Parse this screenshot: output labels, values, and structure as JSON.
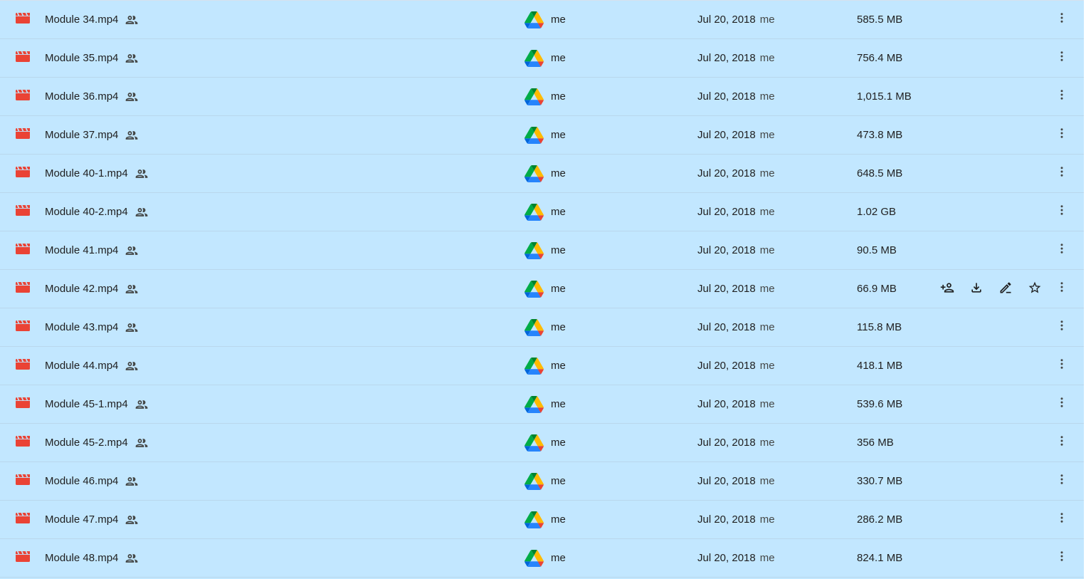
{
  "files": [
    {
      "name": "Module 34.mp4",
      "owner": "me",
      "modified_date": "Jul 20, 2018",
      "modified_by": "me",
      "size": "585.5 MB"
    },
    {
      "name": "Module 35.mp4",
      "owner": "me",
      "modified_date": "Jul 20, 2018",
      "modified_by": "me",
      "size": "756.4 MB"
    },
    {
      "name": "Module 36.mp4",
      "owner": "me",
      "modified_date": "Jul 20, 2018",
      "modified_by": "me",
      "size": "1,015.1 MB"
    },
    {
      "name": "Module 37.mp4",
      "owner": "me",
      "modified_date": "Jul 20, 2018",
      "modified_by": "me",
      "size": "473.8 MB"
    },
    {
      "name": "Module 40-1.mp4",
      "owner": "me",
      "modified_date": "Jul 20, 2018",
      "modified_by": "me",
      "size": "648.5 MB"
    },
    {
      "name": "Module 40-2.mp4",
      "owner": "me",
      "modified_date": "Jul 20, 2018",
      "modified_by": "me",
      "size": "1.02 GB"
    },
    {
      "name": "Module 41.mp4",
      "owner": "me",
      "modified_date": "Jul 20, 2018",
      "modified_by": "me",
      "size": "90.5 MB"
    },
    {
      "name": "Module 42.mp4",
      "owner": "me",
      "modified_date": "Jul 20, 2018",
      "modified_by": "me",
      "size": "66.9 MB",
      "hovered": true
    },
    {
      "name": "Module 43.mp4",
      "owner": "me",
      "modified_date": "Jul 20, 2018",
      "modified_by": "me",
      "size": "115.8 MB"
    },
    {
      "name": "Module 44.mp4",
      "owner": "me",
      "modified_date": "Jul 20, 2018",
      "modified_by": "me",
      "size": "418.1 MB"
    },
    {
      "name": "Module 45-1.mp4",
      "owner": "me",
      "modified_date": "Jul 20, 2018",
      "modified_by": "me",
      "size": "539.6 MB"
    },
    {
      "name": "Module 45-2.mp4",
      "owner": "me",
      "modified_date": "Jul 20, 2018",
      "modified_by": "me",
      "size": "356 MB"
    },
    {
      "name": "Module 46.mp4",
      "owner": "me",
      "modified_date": "Jul 20, 2018",
      "modified_by": "me",
      "size": "330.7 MB"
    },
    {
      "name": "Module 47.mp4",
      "owner": "me",
      "modified_date": "Jul 20, 2018",
      "modified_by": "me",
      "size": "286.2 MB"
    },
    {
      "name": "Module 48.mp4",
      "owner": "me",
      "modified_date": "Jul 20, 2018",
      "modified_by": "me",
      "size": "824.1 MB"
    }
  ],
  "hover_actions": [
    "share-icon",
    "download-icon",
    "rename-icon",
    "star-icon"
  ],
  "icons": {
    "file_type": "video-file-icon",
    "shared": "shared-people-icon",
    "owner": "google-drive-icon",
    "more": "more-vertical-icon"
  },
  "colors": {
    "selection_background": "#c2e7ff",
    "video_icon": "#ea4335",
    "text_primary": "#1f1f1f",
    "text_secondary": "#444746"
  }
}
